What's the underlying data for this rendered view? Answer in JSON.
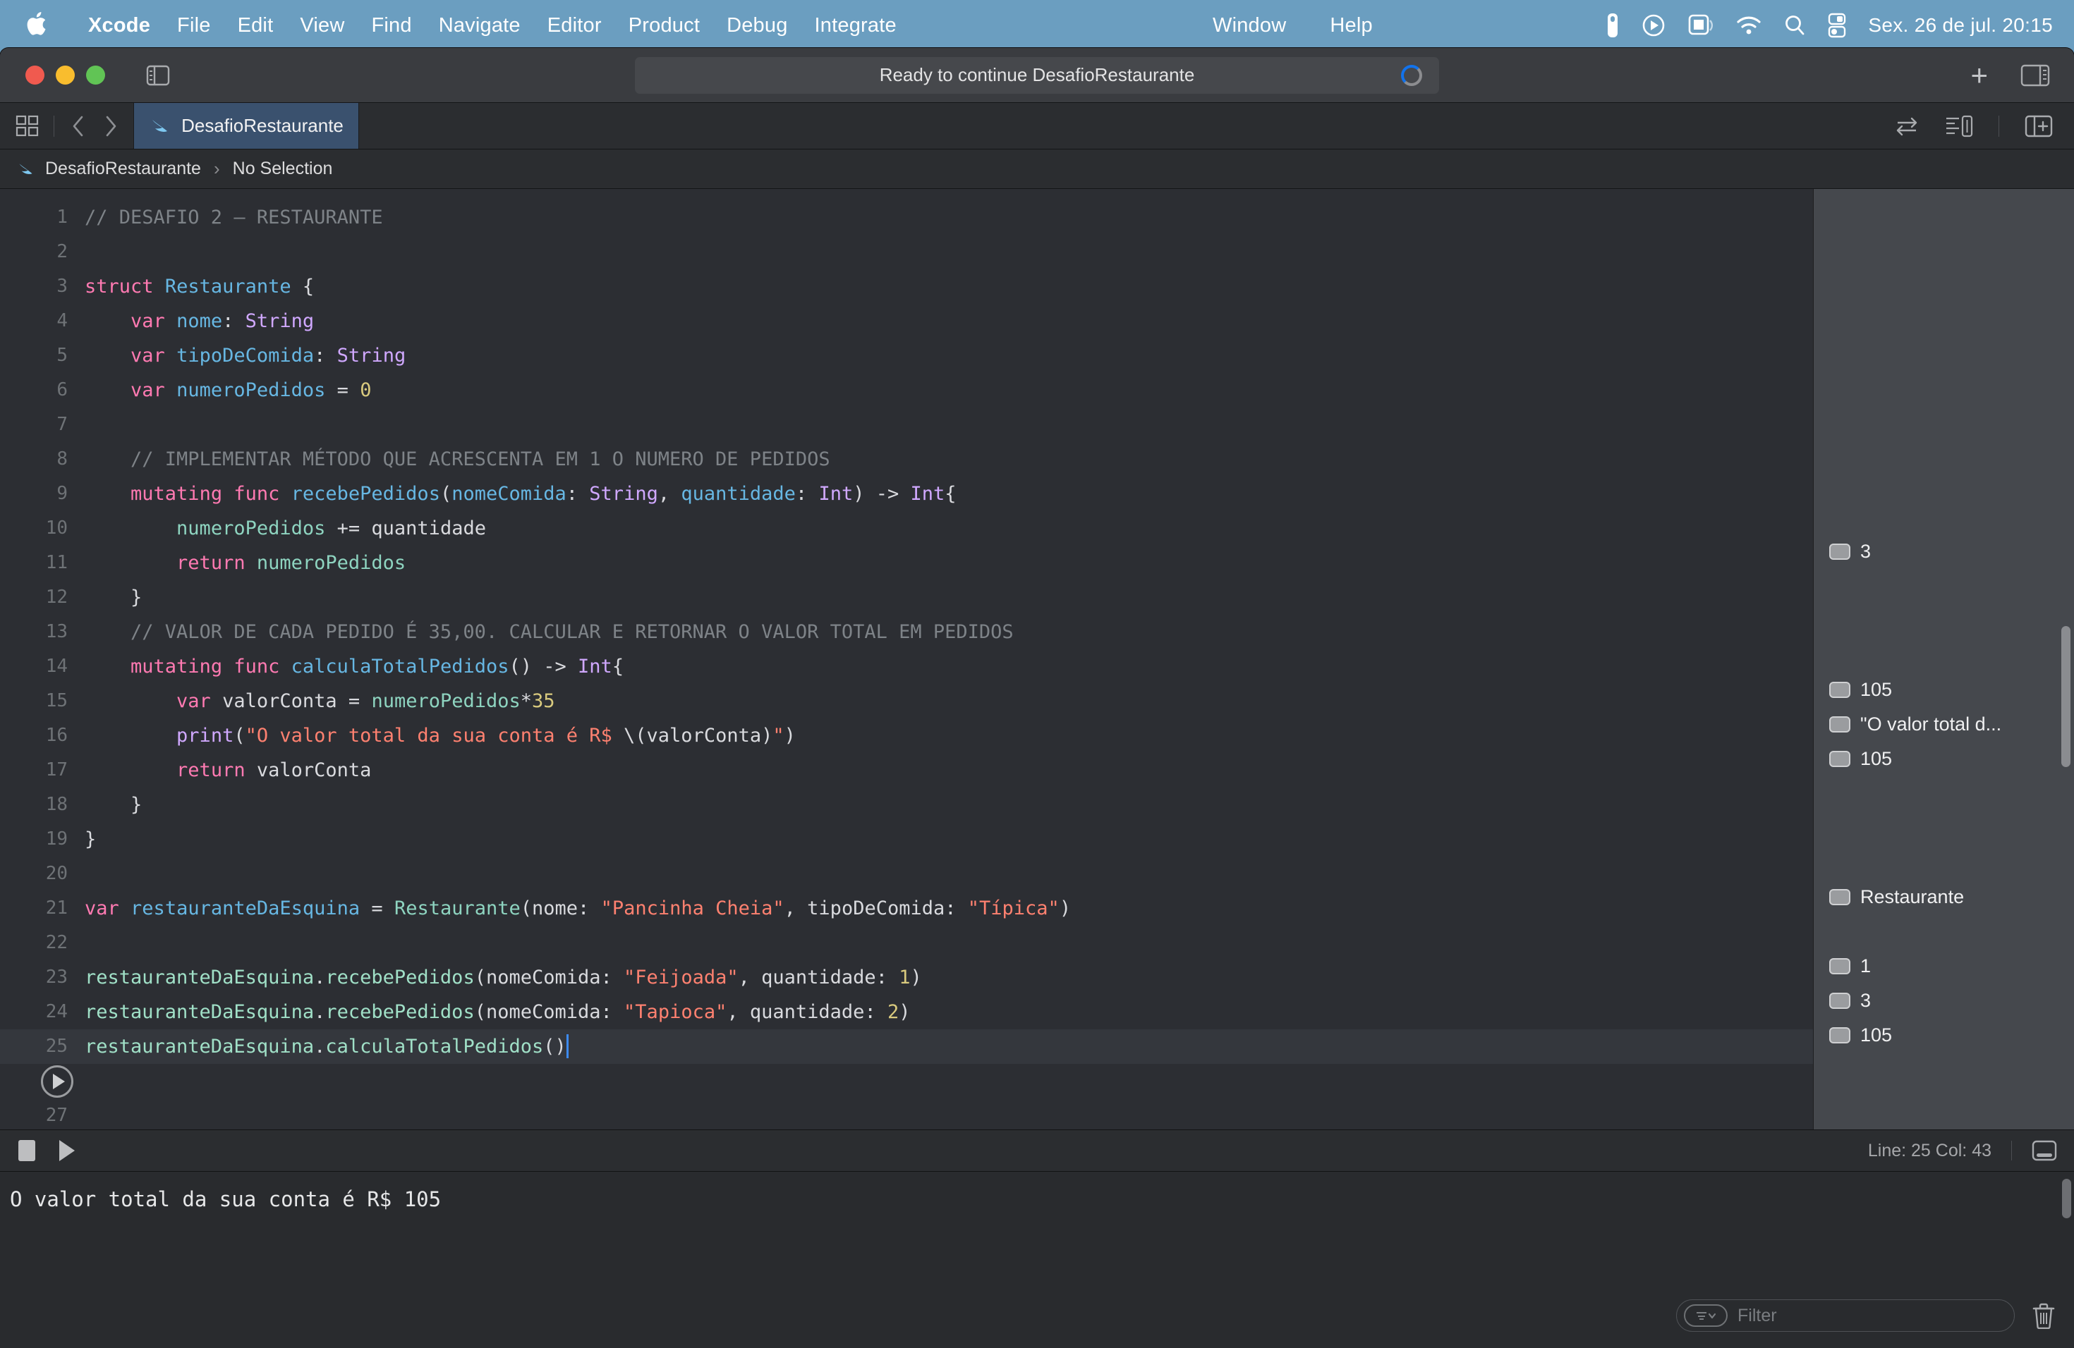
{
  "menubar": {
    "apple_icon": "apple-logo-icon",
    "items": [
      {
        "label": "Xcode",
        "bold": true
      },
      {
        "label": "File",
        "bold": false
      },
      {
        "label": "Edit",
        "bold": false
      },
      {
        "label": "View",
        "bold": false
      },
      {
        "label": "Find",
        "bold": false
      },
      {
        "label": "Navigate",
        "bold": false
      },
      {
        "label": "Editor",
        "bold": false
      },
      {
        "label": "Product",
        "bold": false
      },
      {
        "label": "Debug",
        "bold": false
      },
      {
        "label": "Integrate",
        "bold": false
      },
      {
        "label": "Window",
        "bold": false
      },
      {
        "label": "Help",
        "bold": false
      }
    ],
    "status_icons": [
      "battery-vertical-icon",
      "play-circle-icon",
      "screen-mirroring-icon",
      "wifi-icon",
      "search-icon",
      "control-center-icon"
    ],
    "clock": "Sex. 26 de jul.  20:15"
  },
  "toolbar": {
    "traffic_lights": [
      "close-button",
      "minimize-button",
      "zoom-button"
    ],
    "sidebar_toggle_icon": "sidebar-toggle-icon",
    "status_text": "Ready to continue DesafioRestaurante",
    "activity_spinner": "progress-spinner-icon",
    "add_label": "+",
    "inspector_toggle_icon": "inspector-toggle-icon"
  },
  "tabbar": {
    "grid_icon": "tab-grid-icon",
    "back_icon": "chevron-left-icon",
    "forward_icon": "chevron-right-icon",
    "tab_label": "DesafioRestaurante",
    "tab_file_icon": "swift-file-icon",
    "right_icons": [
      "swap-arrows-icon",
      "minimap-icon",
      "split-editor-add-icon"
    ]
  },
  "breadcrumb": {
    "file_icon": "swift-file-icon",
    "project": "DesafioRestaurante",
    "separator": "›",
    "selection": "No Selection"
  },
  "editor": {
    "lines": [
      {
        "n": "1",
        "current": false,
        "tokens": [
          {
            "t": "// DESAFIO 2 — RESTAURANTE",
            "c": "cmt"
          }
        ]
      },
      {
        "n": "2",
        "current": false,
        "tokens": []
      },
      {
        "n": "3",
        "current": false,
        "tokens": [
          {
            "t": "struct",
            "c": "kw"
          },
          {
            "t": " ",
            "c": "plain"
          },
          {
            "t": "Restaurante",
            "c": "decl"
          },
          {
            "t": " {",
            "c": "plain"
          }
        ]
      },
      {
        "n": "4",
        "current": false,
        "tokens": [
          {
            "t": "    ",
            "c": "plain"
          },
          {
            "t": "var",
            "c": "kw"
          },
          {
            "t": " ",
            "c": "plain"
          },
          {
            "t": "nome",
            "c": "decl"
          },
          {
            "t": ": ",
            "c": "plain"
          },
          {
            "t": "String",
            "c": "type"
          }
        ]
      },
      {
        "n": "5",
        "current": false,
        "tokens": [
          {
            "t": "    ",
            "c": "plain"
          },
          {
            "t": "var",
            "c": "kw"
          },
          {
            "t": " ",
            "c": "plain"
          },
          {
            "t": "tipoDeComida",
            "c": "decl"
          },
          {
            "t": ": ",
            "c": "plain"
          },
          {
            "t": "String",
            "c": "type"
          }
        ]
      },
      {
        "n": "6",
        "current": false,
        "tokens": [
          {
            "t": "    ",
            "c": "plain"
          },
          {
            "t": "var",
            "c": "kw"
          },
          {
            "t": " ",
            "c": "plain"
          },
          {
            "t": "numeroPedidos",
            "c": "decl"
          },
          {
            "t": " = ",
            "c": "plain"
          },
          {
            "t": "0",
            "c": "num"
          }
        ]
      },
      {
        "n": "7",
        "current": false,
        "tokens": []
      },
      {
        "n": "8",
        "current": false,
        "tokens": [
          {
            "t": "    // IMPLEMENTAR MÉTODO QUE ACRESCENTA EM 1 O NUMERO DE PEDIDOS",
            "c": "cmt"
          }
        ]
      },
      {
        "n": "9",
        "current": false,
        "tokens": [
          {
            "t": "    ",
            "c": "plain"
          },
          {
            "t": "mutating func",
            "c": "kw"
          },
          {
            "t": " ",
            "c": "plain"
          },
          {
            "t": "recebePedidos",
            "c": "meth"
          },
          {
            "t": "(",
            "c": "plain"
          },
          {
            "t": "nomeComida",
            "c": "decl"
          },
          {
            "t": ": ",
            "c": "plain"
          },
          {
            "t": "String",
            "c": "type"
          },
          {
            "t": ", ",
            "c": "plain"
          },
          {
            "t": "quantidade",
            "c": "decl"
          },
          {
            "t": ": ",
            "c": "plain"
          },
          {
            "t": "Int",
            "c": "type"
          },
          {
            "t": ") -> ",
            "c": "plain"
          },
          {
            "t": "Int",
            "c": "type"
          },
          {
            "t": "{",
            "c": "plain"
          }
        ]
      },
      {
        "n": "10",
        "current": false,
        "tokens": [
          {
            "t": "        ",
            "c": "plain"
          },
          {
            "t": "numeroPedidos",
            "c": "prop"
          },
          {
            "t": " += ",
            "c": "plain"
          },
          {
            "t": "quantidade",
            "c": "plain"
          }
        ]
      },
      {
        "n": "11",
        "current": false,
        "tokens": [
          {
            "t": "        ",
            "c": "plain"
          },
          {
            "t": "return",
            "c": "kw"
          },
          {
            "t": " ",
            "c": "plain"
          },
          {
            "t": "numeroPedidos",
            "c": "prop"
          }
        ]
      },
      {
        "n": "12",
        "current": false,
        "tokens": [
          {
            "t": "    }",
            "c": "plain"
          }
        ]
      },
      {
        "n": "13",
        "current": false,
        "tokens": [
          {
            "t": "    // VALOR DE CADA PEDIDO É 35,00. CALCULAR E RETORNAR O VALOR TOTAL EM PEDIDOS",
            "c": "cmt"
          }
        ]
      },
      {
        "n": "14",
        "current": false,
        "tokens": [
          {
            "t": "    ",
            "c": "plain"
          },
          {
            "t": "mutating func",
            "c": "kw"
          },
          {
            "t": " ",
            "c": "plain"
          },
          {
            "t": "calculaTotalPedidos",
            "c": "meth"
          },
          {
            "t": "() -> ",
            "c": "plain"
          },
          {
            "t": "Int",
            "c": "type"
          },
          {
            "t": "{",
            "c": "plain"
          }
        ]
      },
      {
        "n": "15",
        "current": false,
        "tokens": [
          {
            "t": "        ",
            "c": "plain"
          },
          {
            "t": "var",
            "c": "kw"
          },
          {
            "t": " ",
            "c": "plain"
          },
          {
            "t": "valorConta",
            "c": "plain"
          },
          {
            "t": " = ",
            "c": "plain"
          },
          {
            "t": "numeroPedidos",
            "c": "prop"
          },
          {
            "t": "*",
            "c": "plain"
          },
          {
            "t": "35",
            "c": "num"
          }
        ]
      },
      {
        "n": "16",
        "current": false,
        "tokens": [
          {
            "t": "        ",
            "c": "plain"
          },
          {
            "t": "print",
            "c": "type"
          },
          {
            "t": "(",
            "c": "plain"
          },
          {
            "t": "\"O valor total da sua conta é R$ ",
            "c": "str"
          },
          {
            "t": "\\(valorConta)",
            "c": "plain"
          },
          {
            "t": "\"",
            "c": "str"
          },
          {
            "t": ")",
            "c": "plain"
          }
        ]
      },
      {
        "n": "17",
        "current": false,
        "tokens": [
          {
            "t": "        ",
            "c": "plain"
          },
          {
            "t": "return",
            "c": "kw"
          },
          {
            "t": " ",
            "c": "plain"
          },
          {
            "t": "valorConta",
            "c": "plain"
          }
        ]
      },
      {
        "n": "18",
        "current": false,
        "tokens": [
          {
            "t": "    }",
            "c": "plain"
          }
        ]
      },
      {
        "n": "19",
        "current": false,
        "tokens": [
          {
            "t": "}",
            "c": "plain"
          }
        ]
      },
      {
        "n": "20",
        "current": false,
        "tokens": []
      },
      {
        "n": "21",
        "current": false,
        "tokens": [
          {
            "t": "var",
            "c": "kw"
          },
          {
            "t": " ",
            "c": "plain"
          },
          {
            "t": "restauranteDaEsquina",
            "c": "decl"
          },
          {
            "t": " = ",
            "c": "plain"
          },
          {
            "t": "Restaurante",
            "c": "prop"
          },
          {
            "t": "(",
            "c": "plain"
          },
          {
            "t": "nome",
            "c": "plain"
          },
          {
            "t": ": ",
            "c": "plain"
          },
          {
            "t": "\"Pancinha Cheia\"",
            "c": "str"
          },
          {
            "t": ", ",
            "c": "plain"
          },
          {
            "t": "tipoDeComida",
            "c": "plain"
          },
          {
            "t": ": ",
            "c": "plain"
          },
          {
            "t": "\"Típica\"",
            "c": "str"
          },
          {
            "t": ")",
            "c": "plain"
          }
        ]
      },
      {
        "n": "22",
        "current": false,
        "tokens": []
      },
      {
        "n": "23",
        "current": false,
        "tokens": [
          {
            "t": "restauranteDaEsquina",
            "c": "glob"
          },
          {
            "t": ".",
            "c": "plain"
          },
          {
            "t": "recebePedidos",
            "c": "glob"
          },
          {
            "t": "(",
            "c": "plain"
          },
          {
            "t": "nomeComida",
            "c": "plain"
          },
          {
            "t": ": ",
            "c": "plain"
          },
          {
            "t": "\"Feijoada\"",
            "c": "str"
          },
          {
            "t": ", ",
            "c": "plain"
          },
          {
            "t": "quantidade",
            "c": "plain"
          },
          {
            "t": ": ",
            "c": "plain"
          },
          {
            "t": "1",
            "c": "num"
          },
          {
            "t": ")",
            "c": "plain"
          }
        ]
      },
      {
        "n": "24",
        "current": false,
        "tokens": [
          {
            "t": "restauranteDaEsquina",
            "c": "glob"
          },
          {
            "t": ".",
            "c": "plain"
          },
          {
            "t": "recebePedidos",
            "c": "glob"
          },
          {
            "t": "(",
            "c": "plain"
          },
          {
            "t": "nomeComida",
            "c": "plain"
          },
          {
            "t": ": ",
            "c": "plain"
          },
          {
            "t": "\"Tapioca\"",
            "c": "str"
          },
          {
            "t": ", ",
            "c": "plain"
          },
          {
            "t": "quantidade",
            "c": "plain"
          },
          {
            "t": ": ",
            "c": "plain"
          },
          {
            "t": "2",
            "c": "num"
          },
          {
            "t": ")",
            "c": "plain"
          }
        ]
      },
      {
        "n": "25",
        "current": true,
        "tokens": [
          {
            "t": "restauranteDaEsquina",
            "c": "glob"
          },
          {
            "t": ".",
            "c": "plain"
          },
          {
            "t": "calculaTotalPedidos",
            "c": "glob"
          },
          {
            "t": "()",
            "c": "plain"
          }
        ],
        "cursor": true
      },
      {
        "n": "",
        "current": false,
        "tokens": [],
        "run_button": true
      },
      {
        "n": "27",
        "current": false,
        "tokens": []
      }
    ]
  },
  "results": {
    "rows": [
      {
        "line": 11,
        "value": "3"
      },
      {
        "line": 15,
        "value": "105"
      },
      {
        "line": 16,
        "value": "\"O valor total d..."
      },
      {
        "line": 17,
        "value": "105"
      },
      {
        "line": 21,
        "value": "Restaurante"
      },
      {
        "line": 23,
        "value": "1"
      },
      {
        "line": 24,
        "value": "3"
      },
      {
        "line": 25,
        "value": "105"
      }
    ]
  },
  "debugbar": {
    "stop_icon": "stop-button",
    "continue_icon": "continue-button",
    "line_col": "Line: 25  Col: 43",
    "console_toggle_icon": "console-toggle-icon"
  },
  "console": {
    "output": "O valor total da sua conta é R$ 105"
  },
  "filterbar": {
    "filter_icon": "filter-options-icon",
    "placeholder": "Filter",
    "trash_icon": "trash-icon"
  },
  "colors": {
    "desktop": "#6b9ec0",
    "toolbar": "#3a3c40",
    "editor_bg": "#2c2e33",
    "results_bg": "#45484d",
    "tab_active": "#3a516e",
    "accent_blue": "#1273ec"
  }
}
